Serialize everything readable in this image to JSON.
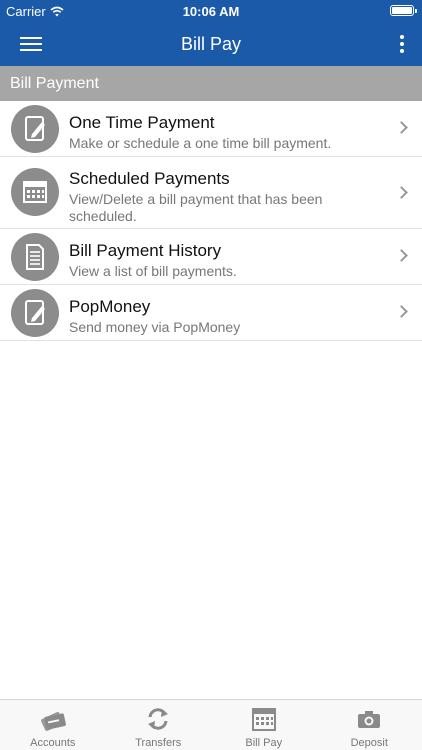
{
  "status_bar": {
    "carrier": "Carrier",
    "time": "10:06 AM"
  },
  "nav": {
    "title": "Bill Pay"
  },
  "section": {
    "header": "Bill Payment"
  },
  "items": [
    {
      "title": "One Time Payment",
      "subtitle": "Make or schedule a one time bill payment.",
      "icon": "edit-document-icon"
    },
    {
      "title": "Scheduled Payments",
      "subtitle": "View/Delete a bill payment that has been scheduled.",
      "icon": "calendar-icon"
    },
    {
      "title": "Bill Payment History",
      "subtitle": "View a list of bill payments.",
      "icon": "document-list-icon"
    },
    {
      "title": "PopMoney",
      "subtitle": "Send money via PopMoney",
      "icon": "edit-document-icon"
    }
  ],
  "tabs": [
    {
      "label": "Accounts",
      "icon": "cards-icon"
    },
    {
      "label": "Transfers",
      "icon": "transfer-arrows-icon"
    },
    {
      "label": "Bill Pay",
      "icon": "calendar-icon"
    },
    {
      "label": "Deposit",
      "icon": "camera-icon"
    }
  ],
  "colors": {
    "brand": "#1a5aa8",
    "section_header": "#a6a6a6",
    "icon_circle": "#8c8c8c",
    "tab_inactive": "#777777"
  }
}
